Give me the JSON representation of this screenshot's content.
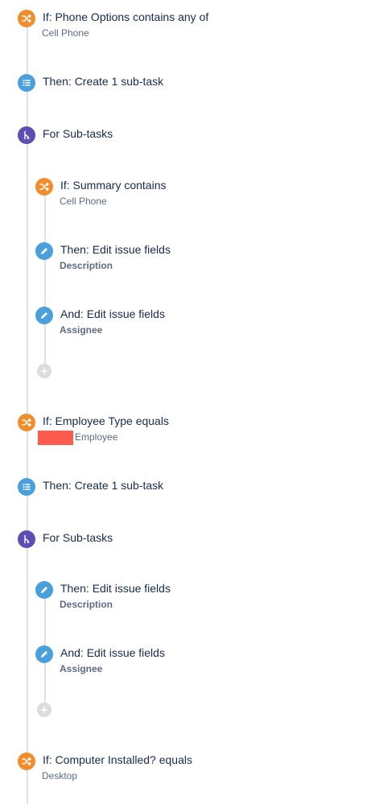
{
  "flow": {
    "n1": {
      "title": "If: Phone Options contains any of",
      "detail": "Cell Phone",
      "icon": "shuffle-icon",
      "color": "#f18d2d"
    },
    "n2": {
      "title": "Then: Create 1 sub-task",
      "icon": "list-icon",
      "color": "#4aa0dc"
    },
    "n3": {
      "title": "For Sub-tasks",
      "icon": "branch-icon",
      "color": "#5e4db2"
    },
    "n4": {
      "title": "If: Summary contains",
      "detail": "Cell Phone",
      "icon": "shuffle-icon",
      "color": "#f18d2d"
    },
    "n5": {
      "title": "Then: Edit issue fields",
      "detail": "Description",
      "icon": "pencil-icon",
      "color": "#4aa0dc"
    },
    "n6": {
      "title": "And: Edit issue fields",
      "detail": "Assignee",
      "icon": "pencil-icon",
      "color": "#4aa0dc"
    },
    "n8": {
      "title": "If: Employee Type equals",
      "detail": "Employee",
      "icon": "shuffle-icon",
      "color": "#f18d2d"
    },
    "n9": {
      "title": "Then: Create 1 sub-task",
      "icon": "list-icon",
      "color": "#4aa0dc"
    },
    "n10": {
      "title": "For Sub-tasks",
      "icon": "branch-icon",
      "color": "#5e4db2"
    },
    "n11": {
      "title": "Then: Edit issue fields",
      "detail": "Description",
      "icon": "pencil-icon",
      "color": "#4aa0dc"
    },
    "n12": {
      "title": "And: Edit issue fields",
      "detail": "Assignee",
      "icon": "pencil-icon",
      "color": "#4aa0dc"
    },
    "n14": {
      "title": "If: Computer Installed? equals",
      "detail": "Desktop",
      "icon": "shuffle-icon",
      "color": "#f18d2d"
    }
  }
}
